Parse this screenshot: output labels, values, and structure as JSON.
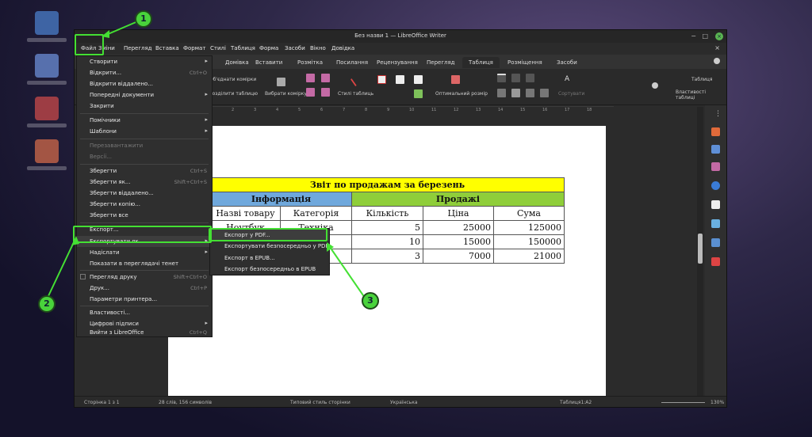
{
  "window": {
    "title": "Без назви 1 — LibreOffice Writer",
    "min_glyph": "−",
    "max_glyph": "□",
    "close_glyph": "×"
  },
  "menubar": {
    "items": [
      "Файл",
      "Зміни",
      "Перегляд",
      "Вставка",
      "Формат",
      "Стилі",
      "Таблиця",
      "Форма",
      "Засоби",
      "Вікно",
      "Довідка"
    ],
    "close_glyph": "×"
  },
  "tabs": {
    "items": [
      "Домівка",
      "Вставити",
      "Розмітка",
      "Посилання",
      "Рецензування",
      "Перегляд",
      "Таблиця",
      "Розміщення",
      "Засоби"
    ],
    "active_index": 6
  },
  "ribbon": {
    "merge_cells": "Об'єднати комірки",
    "split_table": "Розділити таблицю",
    "select_cell": "Вибрати комірку",
    "table_styles": "Стилі таблиць",
    "optimal_size": "Оптимальний розмір",
    "sort": "Сортувати",
    "table_dropdown": "Таблиця",
    "table_props": "Властивості таблиці"
  },
  "ruler": {
    "ticks": [
      "1",
      "2",
      "3",
      "4",
      "5",
      "6",
      "7",
      "8",
      "9",
      "10",
      "11",
      "12",
      "13",
      "14",
      "15",
      "16",
      "17",
      "18"
    ]
  },
  "document": {
    "table": {
      "title": "Звіт по продажам за березень",
      "group_info": "Інформація",
      "group_sales": "Продажі",
      "headers": [
        "Назві товару",
        "Категорія",
        "Кількість",
        "Ціна",
        "Сума"
      ],
      "rows": [
        [
          "Ноутбук",
          "Техніка",
          "5",
          "25000",
          "125000"
        ],
        [
          "",
          "",
          "10",
          "15000",
          "150000"
        ],
        [
          "",
          "",
          "3",
          "7000",
          "21000"
        ]
      ],
      "partial_row1": [
        "Ноутбук",
        "Техніка"
      ]
    }
  },
  "file_menu": {
    "items": [
      {
        "label": "Створити",
        "shortcut": "",
        "arrow": true,
        "disabled": false
      },
      {
        "label": "Відкрити...",
        "shortcut": "Ctrl+O",
        "arrow": false,
        "disabled": false
      },
      {
        "label": "Відкрити віддалено...",
        "shortcut": "",
        "arrow": false,
        "disabled": false
      },
      {
        "label": "Попередні документи",
        "shortcut": "",
        "arrow": true,
        "disabled": false
      },
      {
        "label": "Закрити",
        "shortcut": "",
        "arrow": false,
        "disabled": false
      },
      {
        "label": "Помічники",
        "shortcut": "",
        "arrow": true,
        "disabled": false
      },
      {
        "label": "Шаблони",
        "shortcut": "",
        "arrow": true,
        "disabled": false
      },
      {
        "label": "Перезавантажити",
        "shortcut": "",
        "arrow": false,
        "disabled": true
      },
      {
        "label": "Версії...",
        "shortcut": "",
        "arrow": false,
        "disabled": true
      },
      {
        "label": "Зберегти",
        "shortcut": "Ctrl+S",
        "arrow": false,
        "disabled": false
      },
      {
        "label": "Зберегти як...",
        "shortcut": "Shift+Ctrl+S",
        "arrow": false,
        "disabled": false
      },
      {
        "label": "Зберегти віддалено...",
        "shortcut": "",
        "arrow": false,
        "disabled": false
      },
      {
        "label": "Зберегти копію...",
        "shortcut": "",
        "arrow": false,
        "disabled": false
      },
      {
        "label": "Зберегти все",
        "shortcut": "",
        "arrow": false,
        "disabled": false
      },
      {
        "label": "Експорт...",
        "shortcut": "",
        "arrow": false,
        "disabled": false
      },
      {
        "label": "Експортувати як",
        "shortcut": "",
        "arrow": true,
        "disabled": false
      },
      {
        "label": "Надіслати",
        "shortcut": "",
        "arrow": true,
        "disabled": false
      },
      {
        "label": "Показати в переглядачі тенет",
        "shortcut": "",
        "arrow": false,
        "disabled": false
      },
      {
        "label": "Перегляд друку",
        "shortcut": "Shift+Ctrl+O",
        "arrow": false,
        "disabled": false
      },
      {
        "label": "Друк...",
        "shortcut": "Ctrl+P",
        "arrow": false,
        "disabled": false
      },
      {
        "label": "Параметри принтера...",
        "shortcut": "",
        "arrow": false,
        "disabled": false
      },
      {
        "label": "Властивості...",
        "shortcut": "",
        "arrow": false,
        "disabled": false
      },
      {
        "label": "Цифрові підписи",
        "shortcut": "",
        "arrow": true,
        "disabled": false
      },
      {
        "label": "Вийти з LibreOffice",
        "shortcut": "Ctrl+Q",
        "arrow": false,
        "disabled": false
      }
    ]
  },
  "export_submenu": {
    "items": [
      "Експорт у PDF...",
      "Експортувати безпосередньо у PDF",
      "Експорт в EPUB...",
      "Експорт безпосередньо в EPUB"
    ]
  },
  "statusbar": {
    "page": "Сторінка 1 з 1",
    "words": "28 слів, 156 символів",
    "page_style": "Типовий стиль сторінки",
    "language": "Українська",
    "cell": "Таблиця1:A2",
    "zoom": "130%"
  },
  "callouts": [
    "1",
    "2",
    "3"
  ],
  "colors": {
    "title_bg": "#ffff00",
    "info_bg": "#6fa8dc",
    "sales_bg": "#8fce3a",
    "highlight": "#44e033"
  }
}
